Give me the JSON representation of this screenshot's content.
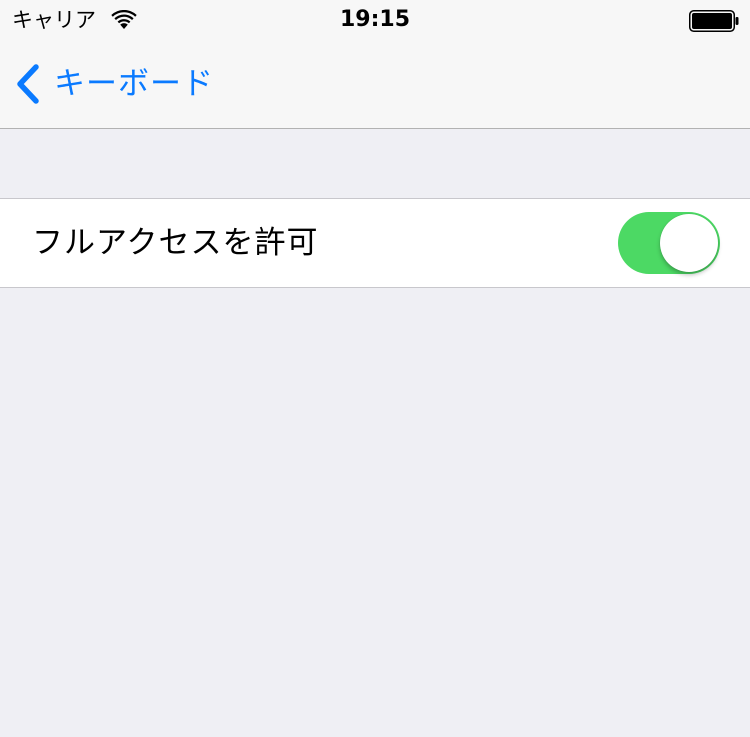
{
  "status_bar": {
    "carrier": "キャリア",
    "time": "19:15",
    "wifi_icon": "wifi-icon",
    "battery_icon": "battery-full-icon",
    "battery_level": 1.0
  },
  "nav_bar": {
    "back_label": "キーボード",
    "back_icon": "chevron-left-icon",
    "accent_color": "#0a7aff"
  },
  "settings": {
    "rows": [
      {
        "label": "フルアクセスを許可",
        "toggle_on": true,
        "toggle_color": "#4cd964"
      }
    ]
  }
}
